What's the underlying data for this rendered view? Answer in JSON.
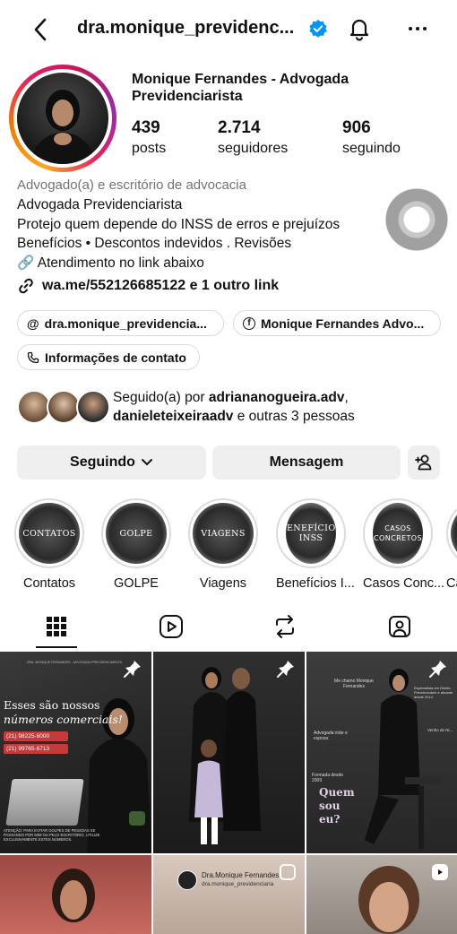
{
  "header": {
    "username": "dra.monique_previdenc...",
    "verified": true
  },
  "profile": {
    "full_name": "Monique Fernandes - Advogada Previdenciarista",
    "stats": [
      {
        "value": "439",
        "label": "posts"
      },
      {
        "value": "2.714",
        "label": "seguidores"
      },
      {
        "value": "906",
        "label": "seguindo"
      }
    ],
    "category": "Advogado(a) e escritório de advocacia",
    "bio": "Advogada Previdenciarista\nProtejo quem depende do INSS de erros e prejuízos\nBenefícios • Descontos indevidos . Revisões\n🔗 Atendimento no link abaixo",
    "link": "wa.me/552126685122 e 1 outro link"
  },
  "chips": {
    "threads": "dra.monique_previdencia...",
    "facebook": "Monique Fernandes Advo...",
    "contact": "Informações de contato"
  },
  "followed_by": {
    "prefix": "Seguido(a) por ",
    "user1": "adriananogueira.adv",
    "sep": ",",
    "user2": "danieleteixeiraadv",
    "suffix": " e outras 3 pessoas"
  },
  "actions": {
    "following": "Seguindo",
    "message": "Mensagem"
  },
  "highlights": [
    {
      "label": "Contatos",
      "cover": "CONTATOS"
    },
    {
      "label": "GOLPE",
      "cover": "GOLPE"
    },
    {
      "label": "Viagens",
      "cover": "VIAGENS"
    },
    {
      "label": "Benefícios I...",
      "cover": "BENEFÍCIOS INSS"
    },
    {
      "label": "Casos Conc...",
      "cover": "CASOS CONCRETOS"
    },
    {
      "label": "Ca",
      "cover": ""
    }
  ],
  "tabs": [
    "grid-icon",
    "reels-icon",
    "reposts-icon",
    "tagged-icon"
  ],
  "posts": {
    "p1": {
      "header": "DRA. MONIQUE FERNANDES - ADVOGADA PREVIDENCIARISTA",
      "title1": "Esses são nossos",
      "title2": "números comerciais!",
      "phone1": "(21) 98225-6000",
      "phone2": "(21) 99765-6713",
      "note": "ATENÇÃO: PARA EVITAR GOLPES DE PESSOAS SE PASSANDO POR MIM OU PELO ESCRITÓRIO, UTILIZE EXCLUSIVAMENTE ESTES NÚMEROS."
    },
    "p3": {
      "a1": "Me chamo Monique Fernandes",
      "a2": "Advogada mãe e esposa",
      "a3": "Formada desde 2009",
      "a4": "Especialista em Direito Previdenciário e atuante desde 2014",
      "a5": "Venho de Ni...",
      "cta": "Quem sou eu?"
    },
    "p5": {
      "name": "Dra.Monique Fernandes",
      "handle": "dra.monique_previdenciaria"
    }
  },
  "colors": {
    "accent": "#0095f6",
    "chip_border": "#dbdbdb",
    "button_bg": "#efefef"
  }
}
